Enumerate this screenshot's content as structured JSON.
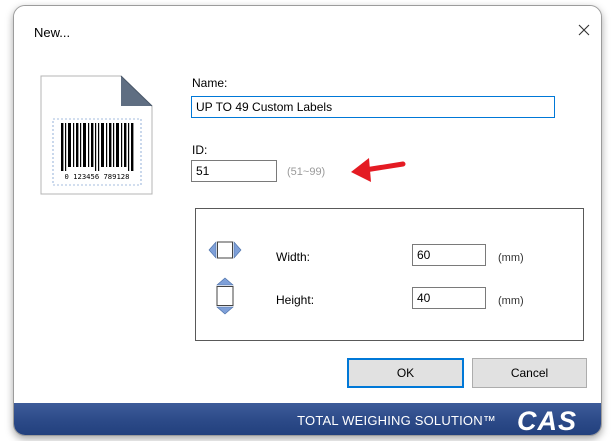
{
  "dialog": {
    "title": "New...",
    "name_label": "Name:",
    "name_value": "UP TO 49 Custom Labels",
    "id_label": "ID:",
    "id_value": "51",
    "id_range": "(51~99)",
    "thumbnail": {
      "barcode_digits": "0 123456 789128"
    },
    "size": {
      "width_label": "Width:",
      "width_value": "60",
      "width_unit": "(mm)",
      "height_label": "Height:",
      "height_value": "40",
      "height_unit": "(mm)"
    },
    "buttons": {
      "ok": "OK",
      "cancel": "Cancel"
    }
  },
  "footer": {
    "slogan": "TOTAL WEIGHING SOLUTION™",
    "logo_text": "CAS",
    "color": "#2c4a88"
  },
  "annotation": {
    "arrow_color": "#e41b23"
  },
  "icons": [
    "close-icon",
    "label-document-icon",
    "width-arrows-icon",
    "height-arrows-icon",
    "red-arrow-icon"
  ]
}
